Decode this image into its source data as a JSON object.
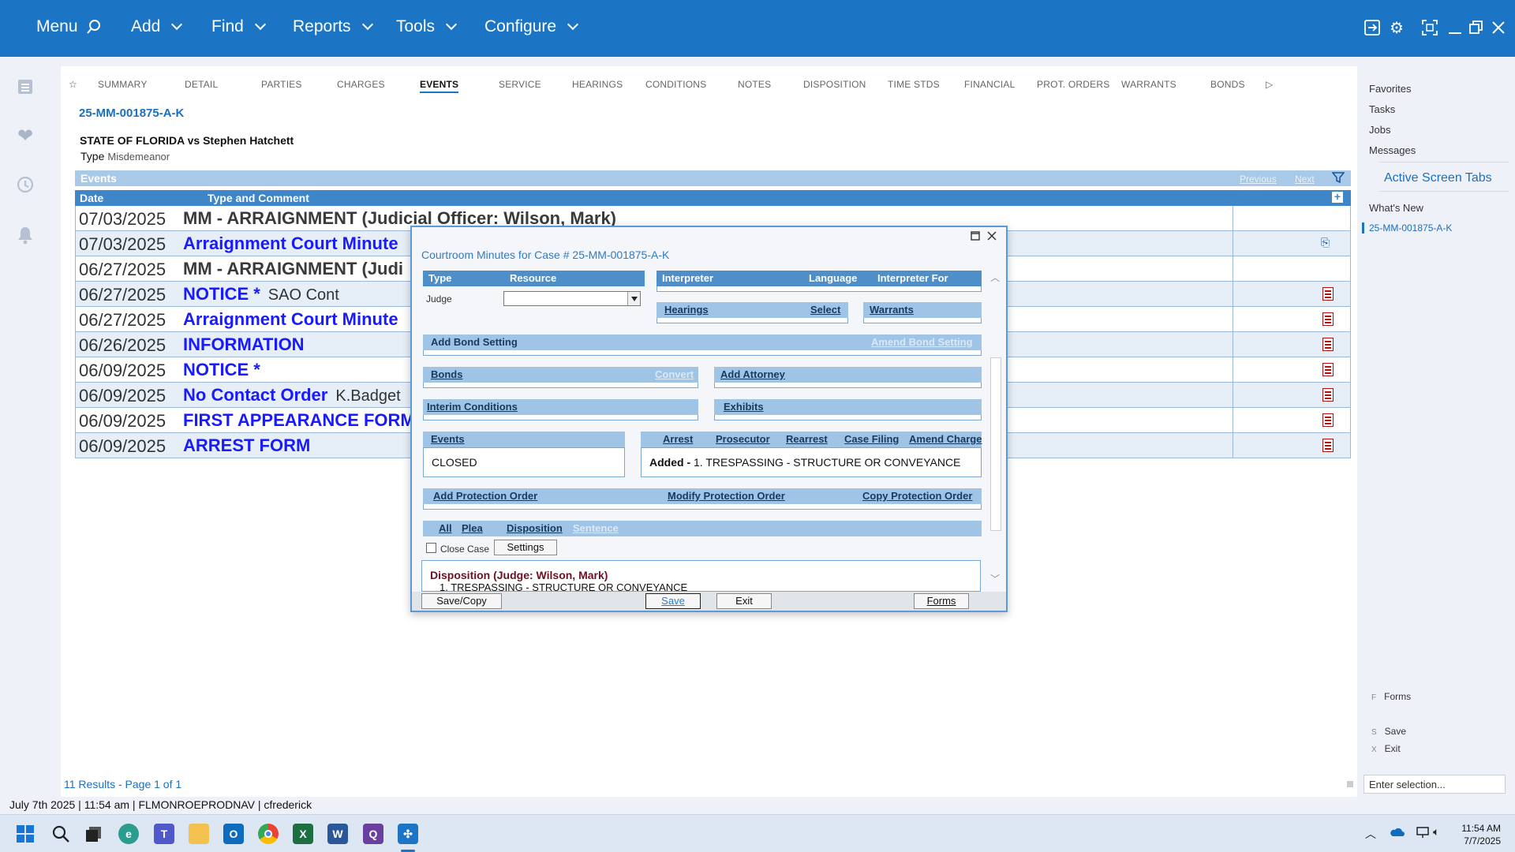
{
  "topbar": {
    "menu": "Menu",
    "add": "Add",
    "find": "Find",
    "reports": "Reports",
    "tools": "Tools",
    "configure": "Configure"
  },
  "tabs": [
    "SUMMARY",
    "DETAIL",
    "PARTIES",
    "CHARGES",
    "EVENTS",
    "SERVICE",
    "HEARINGS",
    "CONDITIONS",
    "NOTES",
    "DISPOSITION",
    "TIME STDS",
    "FINANCIAL",
    "PROT. ORDERS",
    "WARRANTS",
    "BONDS"
  ],
  "active_tab": "EVENTS",
  "case": {
    "number": "25-MM-001875-A-K",
    "title": "STATE OF FLORIDA vs Stephen Hatchett",
    "type_label": "Type",
    "type_value": "Misdemeanor"
  },
  "events": {
    "header": "Events",
    "previous": "Previous",
    "next": "Next",
    "col_date": "Date",
    "col_type": "Type and Comment",
    "rows": [
      {
        "date": "07/03/2025",
        "type": "MM - ARRAIGNMENT (Judicial Officer: Wilson, Mark)",
        "comment": "",
        "dark": true
      },
      {
        "date": "07/03/2025",
        "type": "Arraignment Court Minute",
        "comment": "",
        "dark": false
      },
      {
        "date": "06/27/2025",
        "type": "MM - ARRAIGNMENT (Judi",
        "comment": "",
        "dark": true
      },
      {
        "date": "06/27/2025",
        "type": "NOTICE *",
        "comment": "SAO Cont",
        "dark": false
      },
      {
        "date": "06/27/2025",
        "type": "Arraignment Court Minute",
        "comment": "",
        "dark": false
      },
      {
        "date": "06/26/2025",
        "type": "INFORMATION",
        "comment": "",
        "dark": false
      },
      {
        "date": "06/09/2025",
        "type": "NOTICE *",
        "comment": "",
        "dark": false
      },
      {
        "date": "06/09/2025",
        "type": "No Contact Order",
        "comment": "K.Badget",
        "dark": false
      },
      {
        "date": "06/09/2025",
        "type": "FIRST APPEARANCE FORM",
        "comment": "",
        "dark": false
      },
      {
        "date": "06/09/2025",
        "type": "ARREST FORM",
        "comment": "",
        "dark": false
      }
    ],
    "results": "11 Results - Page 1 of 1"
  },
  "right_pane": {
    "favorites": "Favorites",
    "tasks": "Tasks",
    "jobs": "Jobs",
    "messages": "Messages",
    "active_tabs": "Active Screen Tabs",
    "whats_new": "What's New",
    "case_tab": "25-MM-001875-A-K",
    "forms_key": "F",
    "forms": "Forms",
    "save_key": "S",
    "save": "Save",
    "exit_key": "X",
    "exit": "Exit",
    "enter_selection": "Enter selection..."
  },
  "status": "July 7th 2025 | 11:54 am | FLMONROEPRODNAV | cfrederick",
  "clock": {
    "time": "11:54 AM",
    "date": "7/7/2025"
  },
  "dialog": {
    "title": "Courtroom Minutes for Case # 25-MM-001875-A-K",
    "type_hdr": "Type",
    "resource_hdr": "Resource",
    "judge_label": "Judge",
    "interpreter": "Interpreter",
    "language": "Language",
    "interpreter_for": "Interpreter For",
    "hearings": "Hearings",
    "select": "Select",
    "warrants": "Warrants",
    "add_bond_setting": "Add Bond Setting",
    "amend_bond_setting": "Amend Bond Setting",
    "bonds": "Bonds",
    "convert": "Convert",
    "add_attorney": "Add Attorney",
    "interim_conditions": "Interim Conditions",
    "exhibits": "Exhibits",
    "events": "Events",
    "arrest": "Arrest",
    "prosecutor": "Prosecutor",
    "rearrest": "Rearrest",
    "case_filing": "Case Filing",
    "amend_charge": "Amend Charge",
    "event_status": "CLOSED",
    "added_label": "Added -",
    "added_text": "1. TRESPASSING - STRUCTURE OR CONVEYANCE",
    "add_protection_order": "Add Protection Order",
    "modify_protection_order": "Modify Protection Order",
    "copy_protection_order": "Copy Protection Order",
    "all": "All",
    "plea": "Plea",
    "disposition": "Disposition",
    "sentence": "Sentence",
    "close_case": "Close Case",
    "settings": "Settings",
    "disposition_title": "Disposition (Judge: Wilson, Mark)",
    "disposition_line": "1.  TRESPASSING - STRUCTURE OR CONVEYANCE",
    "save_copy": "Save/Copy",
    "save": "Save",
    "exit": "Exit",
    "forms": "Forms"
  },
  "colors": {
    "brand": "#1b74c4",
    "link": "#1a1aff",
    "header": "#3e86c8"
  }
}
